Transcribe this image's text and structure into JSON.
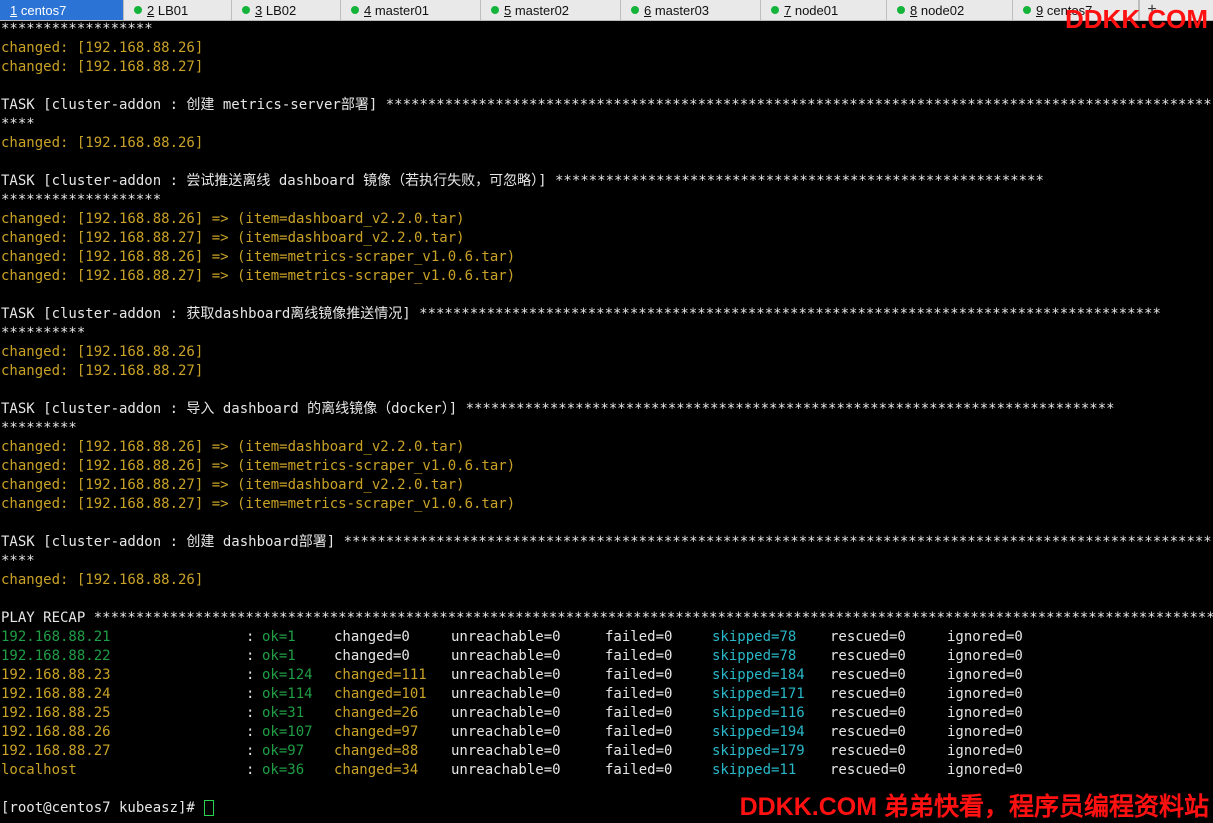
{
  "tabs": [
    {
      "num": "1",
      "label": " centos7",
      "active": true
    },
    {
      "num": "2",
      "label": " LB01"
    },
    {
      "num": "3",
      "label": " LB02"
    },
    {
      "num": "4",
      "label": " master01"
    },
    {
      "num": "5",
      "label": " master02"
    },
    {
      "num": "6",
      "label": " master03"
    },
    {
      "num": "7",
      "label": " node01"
    },
    {
      "num": "8",
      "label": " node02"
    },
    {
      "num": "9",
      "label": " centos7"
    }
  ],
  "tab_add": "+",
  "watermark_top": "DDKK.COM",
  "watermark_bottom": "DDKK.COM 弟弟快看，程序员编程资料站",
  "terminal_lines": [
    {
      "text": "******************",
      "color": "white"
    },
    {
      "text": "changed: [192.168.88.26]",
      "color": "changed"
    },
    {
      "text": "changed: [192.168.88.27]",
      "color": "changed"
    },
    {
      "text": "",
      "color": "white"
    },
    {
      "text": "TASK [cluster-addon : 创建 metrics-server部署] **************************************************************************************************",
      "color": "white"
    },
    {
      "text": "****",
      "color": "white"
    },
    {
      "text": "changed: [192.168.88.26]",
      "color": "changed"
    },
    {
      "text": "",
      "color": "white"
    },
    {
      "text": "TASK [cluster-addon : 尝试推送离线 dashboard 镜像（若执行失败，可忽略）] **********************************************************",
      "color": "white"
    },
    {
      "text": "*******************",
      "color": "white"
    },
    {
      "text": "changed: [192.168.88.26] => (item=dashboard_v2.2.0.tar)",
      "color": "changed"
    },
    {
      "text": "changed: [192.168.88.27] => (item=dashboard_v2.2.0.tar)",
      "color": "changed"
    },
    {
      "text": "changed: [192.168.88.26] => (item=metrics-scraper_v1.0.6.tar)",
      "color": "changed"
    },
    {
      "text": "changed: [192.168.88.27] => (item=metrics-scraper_v1.0.6.tar)",
      "color": "changed"
    },
    {
      "text": "",
      "color": "white"
    },
    {
      "text": "TASK [cluster-addon : 获取dashboard离线镜像推送情况] ****************************************************************************************",
      "color": "white"
    },
    {
      "text": "**********",
      "color": "white"
    },
    {
      "text": "changed: [192.168.88.26]",
      "color": "changed"
    },
    {
      "text": "changed: [192.168.88.27]",
      "color": "changed"
    },
    {
      "text": "",
      "color": "white"
    },
    {
      "text": "TASK [cluster-addon : 导入 dashboard 的离线镜像（docker）] *****************************************************************************",
      "color": "white"
    },
    {
      "text": "*********",
      "color": "white"
    },
    {
      "text": "changed: [192.168.88.26] => (item=dashboard_v2.2.0.tar)",
      "color": "changed"
    },
    {
      "text": "changed: [192.168.88.26] => (item=metrics-scraper_v1.0.6.tar)",
      "color": "changed"
    },
    {
      "text": "changed: [192.168.88.27] => (item=dashboard_v2.2.0.tar)",
      "color": "changed"
    },
    {
      "text": "changed: [192.168.88.27] => (item=metrics-scraper_v1.0.6.tar)",
      "color": "changed"
    },
    {
      "text": "",
      "color": "white"
    },
    {
      "text": "TASK [cluster-addon : 创建 dashboard部署] ********************************************************************************************************",
      "color": "white"
    },
    {
      "text": "****",
      "color": "white"
    },
    {
      "text": "changed: [192.168.88.26]",
      "color": "changed"
    },
    {
      "text": "",
      "color": "white"
    },
    {
      "text": "PLAY RECAP ***********************************************************************************************************************************************",
      "color": "white"
    }
  ],
  "recap_rows": [
    {
      "host": "192.168.88.21",
      "ok": "ok=1",
      "changed": "changed=0",
      "unreachable": "unreachable=0",
      "failed": "failed=0",
      "skipped": "skipped=78",
      "rescued": "rescued=0",
      "ignored": "ignored=0",
      "host_color": "green",
      "changed_color": "white"
    },
    {
      "host": "192.168.88.22",
      "ok": "ok=1",
      "changed": "changed=0",
      "unreachable": "unreachable=0",
      "failed": "failed=0",
      "skipped": "skipped=78",
      "rescued": "rescued=0",
      "ignored": "ignored=0",
      "host_color": "green",
      "changed_color": "white"
    },
    {
      "host": "192.168.88.23",
      "ok": "ok=124",
      "changed": "changed=111",
      "unreachable": "unreachable=0",
      "failed": "failed=0",
      "skipped": "skipped=184",
      "rescued": "rescued=0",
      "ignored": "ignored=0",
      "host_color": "changed",
      "changed_color": "changed"
    },
    {
      "host": "192.168.88.24",
      "ok": "ok=114",
      "changed": "changed=101",
      "unreachable": "unreachable=0",
      "failed": "failed=0",
      "skipped": "skipped=171",
      "rescued": "rescued=0",
      "ignored": "ignored=0",
      "host_color": "changed",
      "changed_color": "changed"
    },
    {
      "host": "192.168.88.25",
      "ok": "ok=31",
      "changed": "changed=26",
      "unreachable": "unreachable=0",
      "failed": "failed=0",
      "skipped": "skipped=116",
      "rescued": "rescued=0",
      "ignored": "ignored=0",
      "host_color": "changed",
      "changed_color": "changed"
    },
    {
      "host": "192.168.88.26",
      "ok": "ok=107",
      "changed": "changed=97",
      "unreachable": "unreachable=0",
      "failed": "failed=0",
      "skipped": "skipped=194",
      "rescued": "rescued=0",
      "ignored": "ignored=0",
      "host_color": "changed",
      "changed_color": "changed"
    },
    {
      "host": "192.168.88.27",
      "ok": "ok=97",
      "changed": "changed=88",
      "unreachable": "unreachable=0",
      "failed": "failed=0",
      "skipped": "skipped=179",
      "rescued": "rescued=0",
      "ignored": "ignored=0",
      "host_color": "changed",
      "changed_color": "changed"
    },
    {
      "host": "localhost",
      "ok": "ok=36",
      "changed": "changed=34",
      "unreachable": "unreachable=0",
      "failed": "failed=0",
      "skipped": "skipped=11",
      "rescued": "rescued=0",
      "ignored": "ignored=0",
      "host_color": "changed",
      "changed_color": "changed"
    }
  ],
  "separator": ":",
  "prompt": "[root@centos7 kubeasz]# ",
  "colors": {
    "changed": "#c9a227",
    "ok": "#1f9e46",
    "skipped": "#29b8c8",
    "default": "#e6e6e6",
    "active_tab": "#2b74d6",
    "watermark": "#ff1111"
  }
}
